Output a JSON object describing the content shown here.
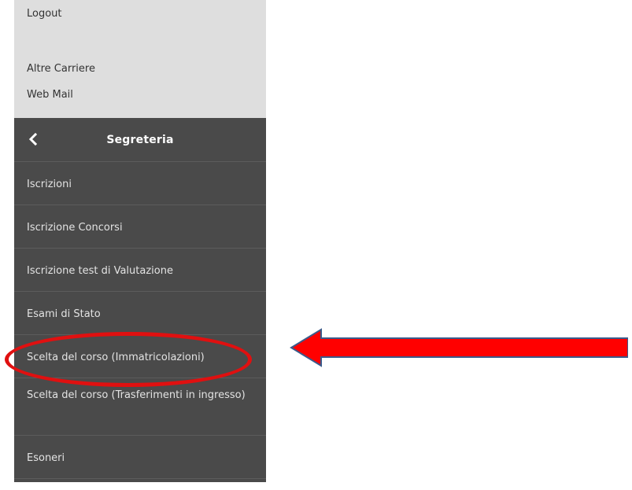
{
  "sidebar": {
    "top_links": {
      "logout": "Logout",
      "altre_carriere": "Altre Carriere",
      "web_mail": "Web Mail"
    },
    "menu": {
      "title": "Segreteria",
      "back_icon": "chevron-left-icon",
      "items": [
        {
          "label": "Iscrizioni"
        },
        {
          "label": "Iscrizione Concorsi"
        },
        {
          "label": "Iscrizione test di Valutazione"
        },
        {
          "label": "Esami di Stato"
        },
        {
          "label": "Scelta del corso (Immatricolazioni)"
        },
        {
          "label": "Scelta del corso (Trasferimenti in ingresso)"
        },
        {
          "label": "Esoneri"
        }
      ]
    }
  },
  "annotations": {
    "highlight_color": "#e01010",
    "arrow_fill": "#ff0000",
    "arrow_stroke": "#3b5a8a"
  },
  "colors": {
    "sidebar_top_bg": "#dedede",
    "sidebar_menu_bg": "#4a4a4a"
  }
}
